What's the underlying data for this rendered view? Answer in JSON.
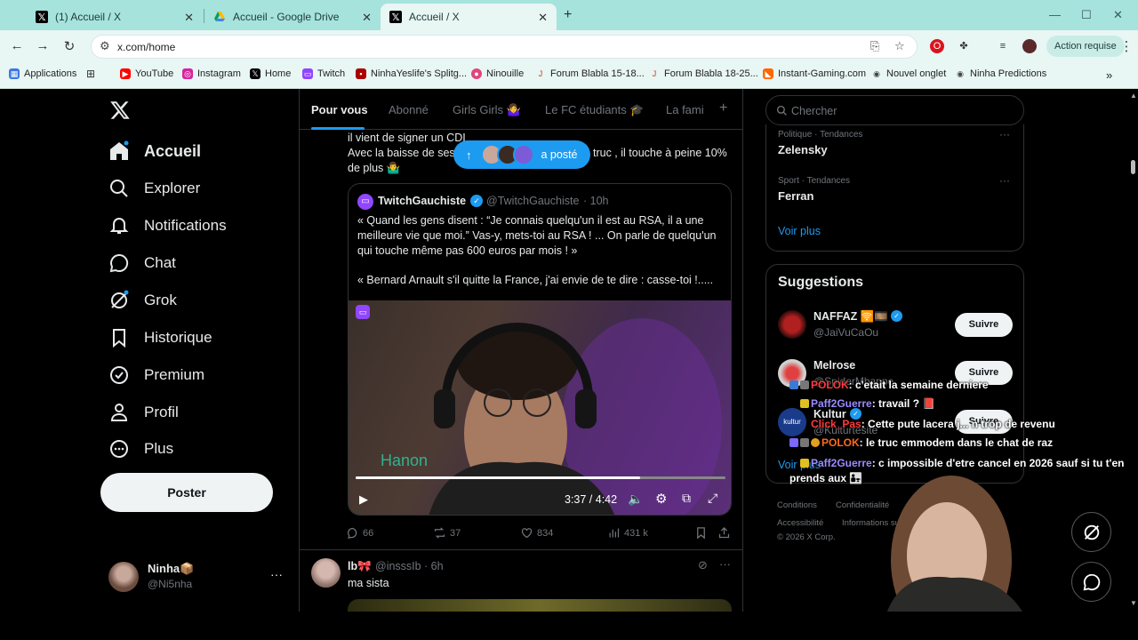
{
  "browser": {
    "tabs": [
      {
        "title": "(1) Accueil / X",
        "active": false
      },
      {
        "title": "Accueil - Google Drive",
        "active": false
      },
      {
        "title": "Accueil / X",
        "active": true
      }
    ],
    "url": "x.com/home",
    "action_required": "Action requise",
    "bookmarks": [
      "Applications",
      "YouTube",
      "Instagram",
      "Home",
      "Twitch",
      "NinhaYeslife's Splitg...",
      "Ninouille",
      "Forum Blabla 15-18...",
      "Forum Blabla 18-25...",
      "Instant-Gaming.com",
      "Nouvel onglet",
      "Ninha Predictions"
    ]
  },
  "nav": {
    "home": "Accueil",
    "explore": "Explorer",
    "notifications": "Notifications",
    "chat": "Chat",
    "grok": "Grok",
    "history": "Historique",
    "premium": "Premium",
    "profile": "Profil",
    "more": "Plus",
    "post_button": "Poster",
    "account_name": "Ninha📦",
    "account_handle": "@Ni5nha"
  },
  "feed_tabs": [
    "Pour vous",
    "Abonné",
    "Girls Girls 🤷‍♀️",
    "Le FC étudiants 🎓",
    "La fami"
  ],
  "post1": {
    "line1": "il vient de signer un CDI",
    "line2a": "Avec la baisse de ses",
    "line2b": "truc , il touche à peine 10%",
    "line3": "de plus 🤷‍♂️",
    "posted_pill": "a posté",
    "quote": {
      "name": "TwitchGauchiste",
      "handle": "@TwitchGauchiste",
      "time": "· 10h",
      "para1": "« Quand les gens disent : “Je connais quelqu'un il est au RSA, il a une meilleure vie que moi.” Vas-y, mets-toi au RSA ! ... On parle de quelqu'un qui touche même pas 600 euros par mois ! »",
      "para2": "« Bernard Arnault s'il quitte la France, j'ai envie de te dire :  casse-toi !.....",
      "video_time": "3:37 / 4:42",
      "video_progress": 0.77
    },
    "stats": {
      "replies": "66",
      "reposts": "37",
      "likes": "834",
      "views": "431 k"
    }
  },
  "post2": {
    "name": "lb🎀",
    "handle": "@insssIb",
    "time": "· 6h",
    "text": "ma sista"
  },
  "right": {
    "search_placeholder": "Chercher",
    "trends": [
      {
        "category": "Politique · Tendances",
        "name": "Zelensky"
      },
      {
        "category": "Sport · Tendances",
        "name": "Ferran"
      }
    ],
    "see_more": "Voir plus",
    "suggestions_title": "Suggestions",
    "suggestions": [
      {
        "name": "NAFFAZ 🛜🎞️",
        "handle": "@JaiVuCaOu",
        "button": "Suivre"
      },
      {
        "name": "Melrose",
        "handle": "@SpiderMbappe",
        "button": "Suivre"
      },
      {
        "name": "Kultur",
        "handle": "@Kulturtesite",
        "button": "Suivre"
      }
    ],
    "footer": [
      "Conditions",
      "Confidentialité",
      "C",
      "Accessibilité",
      "Informations sur l",
      "© 2026 X Corp."
    ]
  },
  "chat_overlay": [
    {
      "user": "POLOK",
      "text": ": c'etait la semaine derniere"
    },
    {
      "user": "Paff2Guerre",
      "text": ": travail ? 📕"
    },
    {
      "user": "Click_Pas",
      "text": ": Cette pute lacera j... n trop de revenu"
    },
    {
      "user": "POLOK",
      "text": ": le truc emmodem dans le chat de raz"
    },
    {
      "user": "Paff2Guerre",
      "text": ": c impossible d'etre cancel en 2026 sauf si tu t'en"
    },
    {
      "user": "",
      "text": "prends aux 👨‍👧"
    }
  ],
  "colors": {
    "accent": "#1d9bf0",
    "chrome": "#a6e3dd",
    "chrome_light": "#e8f6f4"
  }
}
